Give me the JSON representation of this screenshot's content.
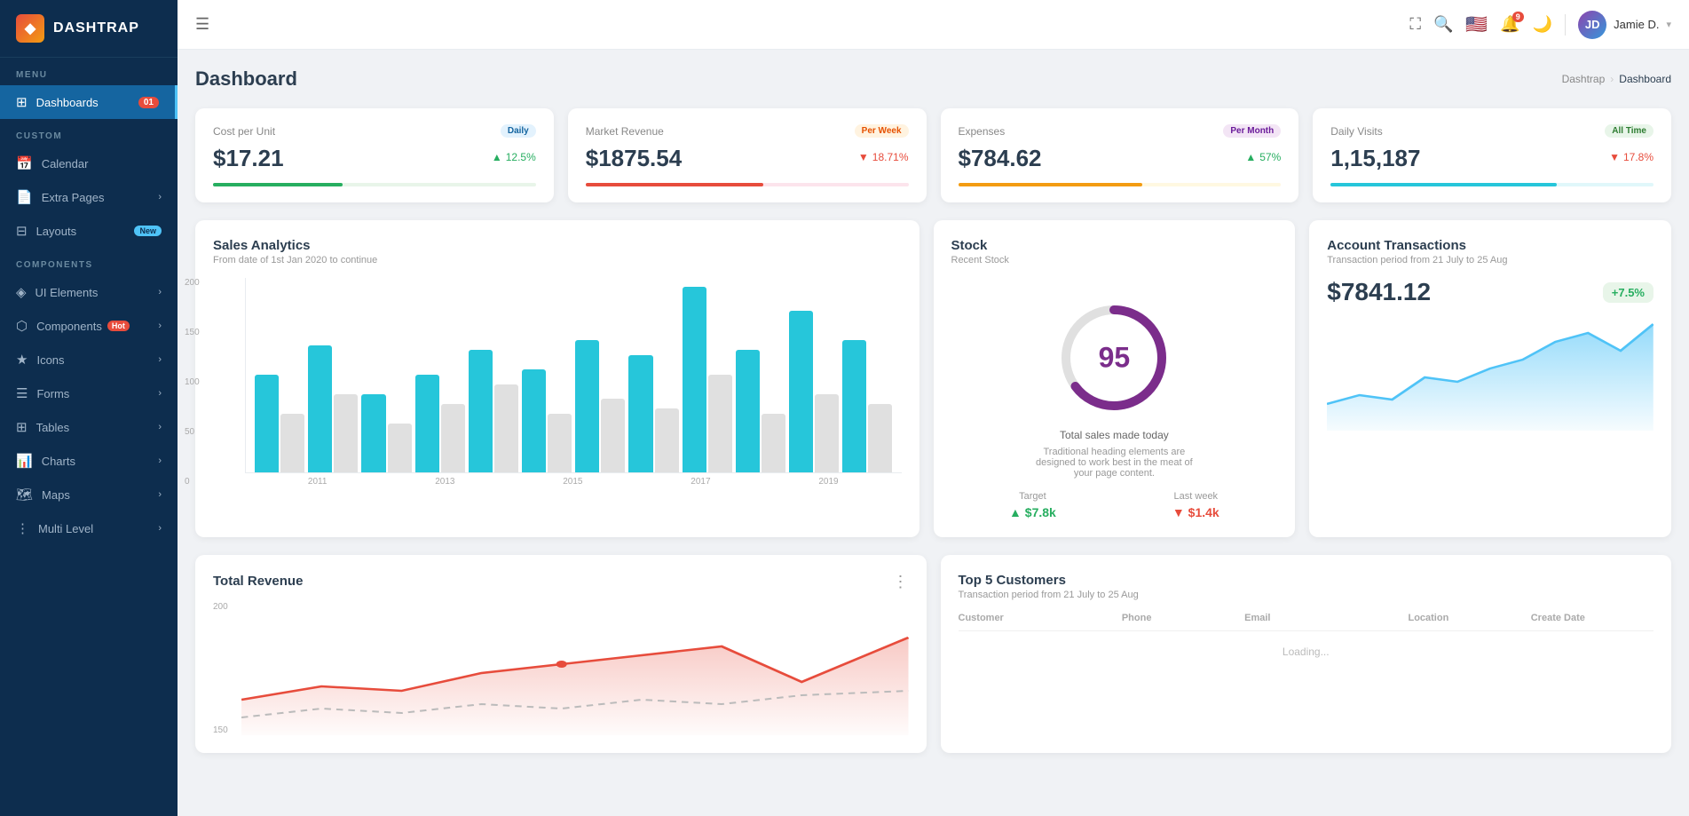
{
  "sidebar": {
    "logo": "DASHTRAP",
    "menu_label": "MENU",
    "custom_label": "CUSTOM",
    "components_label": "COMPONENTS",
    "items": [
      {
        "id": "dashboards",
        "label": "Dashboards",
        "icon": "⊞",
        "badge": "01",
        "active": true
      },
      {
        "id": "calendar",
        "label": "Calendar",
        "icon": "📅",
        "badge": null
      },
      {
        "id": "extra-pages",
        "label": "Extra Pages",
        "icon": "📄",
        "arrow": "›"
      },
      {
        "id": "layouts",
        "label": "Layouts",
        "icon": "⊟",
        "badge_new": "New"
      },
      {
        "id": "ui-elements",
        "label": "UI Elements",
        "icon": "◈",
        "arrow": "›"
      },
      {
        "id": "components",
        "label": "Components",
        "icon": "⬡",
        "badge_hot": "Hot",
        "arrow": "›"
      },
      {
        "id": "icons",
        "label": "Icons",
        "icon": "★",
        "arrow": "›"
      },
      {
        "id": "forms",
        "label": "Forms",
        "icon": "☰",
        "arrow": "›"
      },
      {
        "id": "tables",
        "label": "Tables",
        "icon": "⊞",
        "arrow": "›"
      },
      {
        "id": "charts",
        "label": "Charts",
        "icon": "📊",
        "arrow": "›"
      },
      {
        "id": "maps",
        "label": "Maps",
        "icon": "🗺",
        "arrow": "›"
      },
      {
        "id": "multi-level",
        "label": "Multi Level",
        "icon": "⋮",
        "arrow": "›"
      }
    ]
  },
  "topbar": {
    "hamburger": "☰",
    "fullscreen_icon": "⛶",
    "search_icon": "🔍",
    "flag": "🇺🇸",
    "notif_count": "9",
    "theme_icon": "🌙",
    "user_name": "Jamie D.",
    "user_initials": "JD"
  },
  "page": {
    "title": "Dashboard",
    "breadcrumb_home": "Dashtrap",
    "breadcrumb_current": "Dashboard"
  },
  "stat_cards": [
    {
      "label": "Cost per Unit",
      "badge": "Daily",
      "badge_class": "badge-daily",
      "value": "$17.21",
      "change": "12.5%",
      "change_dir": "up",
      "bar_color": "#27ae60",
      "bar_width": "40%"
    },
    {
      "label": "Market Revenue",
      "badge": "Per Week",
      "badge_class": "badge-perweek",
      "value": "$1875.54",
      "change": "18.71%",
      "change_dir": "down",
      "bar_color": "#e74c3c",
      "bar_width": "55%"
    },
    {
      "label": "Expenses",
      "badge": "Per Month",
      "badge_class": "badge-permonth",
      "value": "$784.62",
      "change": "57%",
      "change_dir": "up",
      "bar_color": "#f39c12",
      "bar_width": "57%"
    },
    {
      "label": "Daily Visits",
      "badge": "All Time",
      "badge_class": "badge-alltime",
      "value": "1,15,187",
      "change": "17.8%",
      "change_dir": "down",
      "bar_color": "#26c6da",
      "bar_width": "70%"
    }
  ],
  "sales_analytics": {
    "title": "Sales Analytics",
    "subtitle": "From date of 1st Jan 2020 to continue",
    "y_labels": [
      "200",
      "150",
      "100",
      "50",
      "0"
    ],
    "x_labels": [
      "2011",
      "2013",
      "2015",
      "2017",
      "2019"
    ],
    "bars": [
      {
        "teal": 100,
        "gray": 60
      },
      {
        "teal": 130,
        "gray": 80
      },
      {
        "teal": 80,
        "gray": 50
      },
      {
        "teal": 100,
        "gray": 70
      },
      {
        "teal": 125,
        "gray": 90
      },
      {
        "teal": 105,
        "gray": 60
      },
      {
        "teal": 135,
        "gray": 75
      },
      {
        "teal": 120,
        "gray": 65
      },
      {
        "teal": 190,
        "gray": 100
      },
      {
        "teal": 125,
        "gray": 60
      },
      {
        "teal": 165,
        "gray": 80
      },
      {
        "teal": 135,
        "gray": 70
      }
    ],
    "max": 200
  },
  "stock": {
    "title": "Stock",
    "subtitle": "Recent Stock",
    "donut_value": "95",
    "desc": "Total sales made today",
    "desc_small": "Traditional heading elements are designed to work best in the meat of your page content.",
    "target_label": "Target",
    "target_value": "$7.8k",
    "last_week_label": "Last week",
    "last_week_value": "$1.4k"
  },
  "account_transactions": {
    "title": "Account Transactions",
    "subtitle": "Transaction period from 21 July to 25 Aug",
    "amount": "$7841.12",
    "change": "+7.5%"
  },
  "total_revenue": {
    "title": "Total Revenue",
    "y_labels": [
      "200",
      "150"
    ],
    "subtitle": ""
  },
  "top_customers": {
    "title": "Top 5 Customers",
    "subtitle": "Transaction period from 21 July to 25 Aug",
    "columns": [
      "Customer",
      "Phone",
      "Email",
      "Location",
      "Create Date"
    ]
  }
}
